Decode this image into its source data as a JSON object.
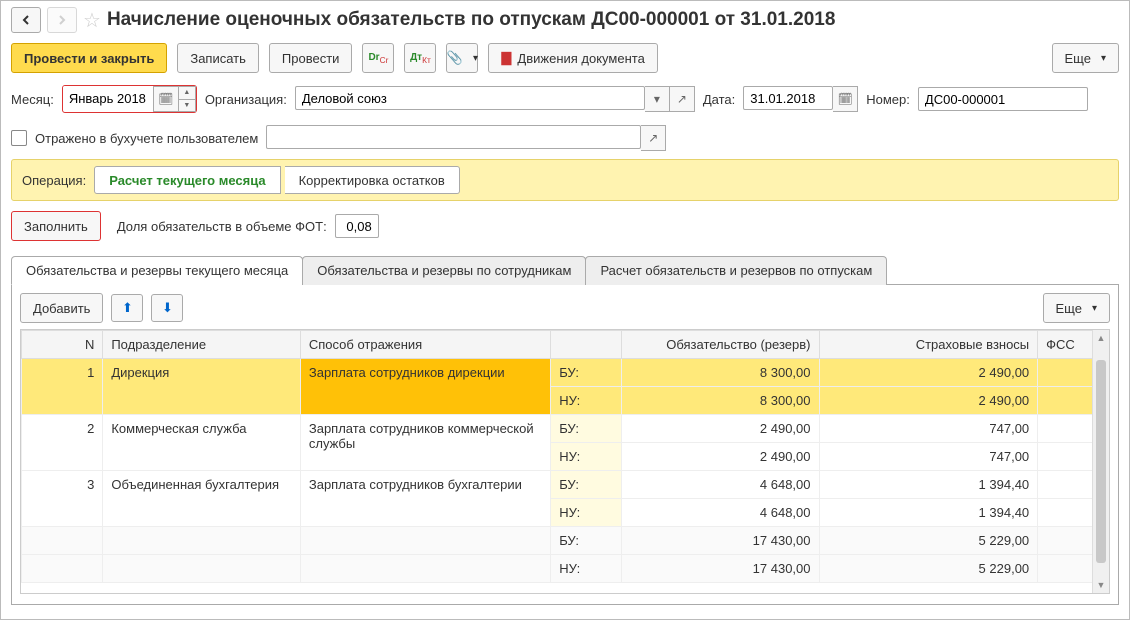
{
  "title": "Начисление оценочных обязательств по отпускам ДС00-000001 от 31.01.2018",
  "toolbar": {
    "post_close": "Провести и закрыть",
    "save": "Записать",
    "post": "Провести",
    "motions": "Движения документа",
    "more": "Еще"
  },
  "fields": {
    "month_label": "Месяц:",
    "month_value": "Январь 2018",
    "org_label": "Организация:",
    "org_value": "Деловой союз",
    "date_label": "Дата:",
    "date_value": "31.01.2018",
    "number_label": "Номер:",
    "number_value": "ДС00-000001",
    "user_reflected": "Отражено в бухучете пользователем",
    "operation_label": "Операция:",
    "fill": "Заполнить",
    "share_label": "Доля обязательств в объеме ФОТ:",
    "share_value": "0,08",
    "add": "Добавить"
  },
  "operation_segments": {
    "current": "Расчет текущего месяца",
    "adjust": "Корректировка остатков"
  },
  "tabs": {
    "t1": "Обязательства и резервы текущего месяца",
    "t2": "Обязательства и резервы по сотрудникам",
    "t3": "Расчет обязательств и резервов по отпускам"
  },
  "table": {
    "headers": {
      "n": "N",
      "dept": "Подразделение",
      "method": "Способ отражения",
      "bn": "",
      "oblig": "Обязательство (резерв)",
      "insur": "Страховые взносы",
      "fss": "ФСС"
    },
    "rows": [
      {
        "n": "1",
        "dept": "Дирекция",
        "method": "Зарплата сотрудников дирекции",
        "bu_oblig": "8 300,00",
        "bu_insur": "2 490,00",
        "nu_oblig": "8 300,00",
        "nu_insur": "2 490,00",
        "selected": true
      },
      {
        "n": "2",
        "dept": "Коммерческая служба",
        "method": "Зарплата сотрудников коммерческой службы",
        "bu_oblig": "2 490,00",
        "bu_insur": "747,00",
        "nu_oblig": "2 490,00",
        "nu_insur": "747,00"
      },
      {
        "n": "3",
        "dept": "Объединенная бухгалтерия",
        "method": "Зарплата сотрудников бухгалтерии",
        "bu_oblig": "4 648,00",
        "bu_insur": "1 394,40",
        "nu_oblig": "4 648,00",
        "nu_insur": "1 394,40"
      }
    ],
    "totals": {
      "bu_oblig": "17 430,00",
      "bu_insur": "5 229,00",
      "nu_oblig": "17 430,00",
      "nu_insur": "5 229,00"
    },
    "labels": {
      "bu": "БУ:",
      "nu": "НУ:"
    }
  }
}
